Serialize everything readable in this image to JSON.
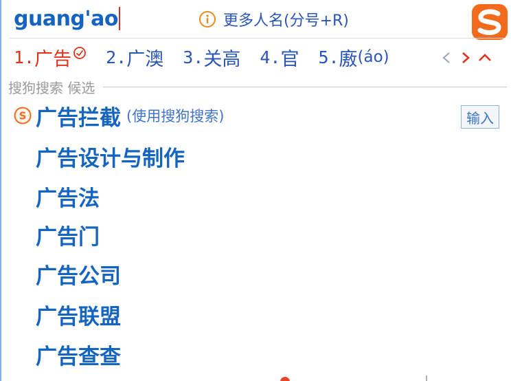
{
  "composition": {
    "text": "guang'ao"
  },
  "name_hint": {
    "icon": "info-icon",
    "label": "更多人名(分号+R)"
  },
  "logo": {
    "icon": "sogou-logo-icon",
    "color": "#f26b1d"
  },
  "candidates": [
    {
      "num": "1.",
      "text": "广告",
      "selected": true
    },
    {
      "num": "2.",
      "text": "广澳"
    },
    {
      "num": "3.",
      "text": "关高"
    },
    {
      "num": "4.",
      "text": "官"
    },
    {
      "num": "5.",
      "text": "廒",
      "pron": "(áo)"
    }
  ],
  "pager": {
    "prev_icon": "chevron-left-icon",
    "next_icon": "chevron-right-icon",
    "collapse_icon": "chevron-up-icon"
  },
  "section": {
    "label": "搜狗搜索 候选"
  },
  "suggestions": [
    {
      "text": "广告拦截",
      "sub": "(使用搜狗搜索)"
    },
    {
      "text": "广告设计与制作"
    },
    {
      "text": "广告法"
    },
    {
      "text": "广告门"
    },
    {
      "text": "广告公司"
    },
    {
      "text": "广告联盟"
    },
    {
      "text": "广告查查"
    }
  ],
  "input_button": {
    "label": "输入"
  },
  "colors": {
    "accent_blue": "#1565c0",
    "link_blue": "#2a56b8",
    "selected_red": "#e0331a",
    "brand_orange": "#f26b1d"
  }
}
